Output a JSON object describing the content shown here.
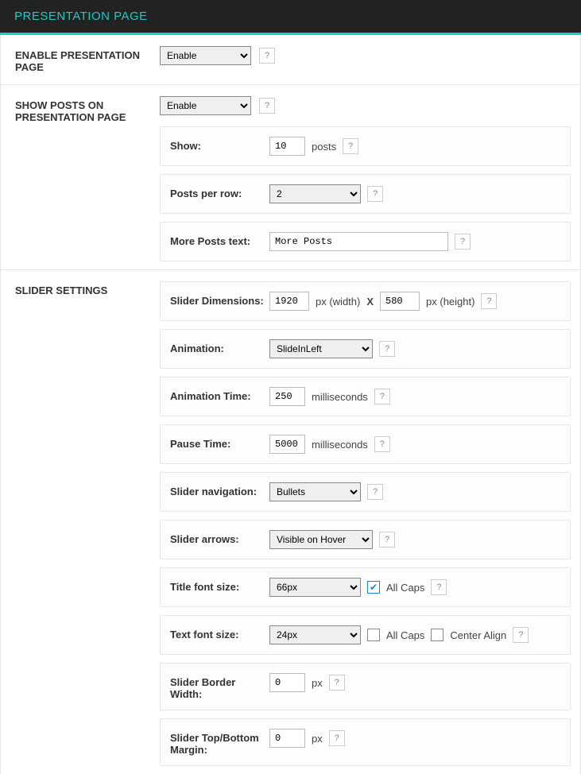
{
  "header": {
    "title": "PRESENTATION PAGE"
  },
  "enable_page": {
    "label": "Enable Presentation Page",
    "value": "Enable"
  },
  "show_posts": {
    "label": "Show Posts on Presentation Page",
    "value": "Enable",
    "show": {
      "label": "Show:",
      "value": "10",
      "unit": "posts"
    },
    "per_row": {
      "label": "Posts per row:",
      "value": "2"
    },
    "more_text": {
      "label": "More Posts text:",
      "value": "More Posts"
    }
  },
  "slider": {
    "label": "Slider Settings",
    "dimensions": {
      "label": "Slider Dimensions:",
      "width": "1920",
      "width_unit": "px (width)",
      "sep": "X",
      "height": "580",
      "height_unit": "px (height)"
    },
    "animation": {
      "label": "Animation:",
      "value": "SlideInLeft"
    },
    "animation_time": {
      "label": "Animation Time:",
      "value": "250",
      "unit": "milliseconds"
    },
    "pause_time": {
      "label": "Pause Time:",
      "value": "5000",
      "unit": "milliseconds"
    },
    "navigation": {
      "label": "Slider navigation:",
      "value": "Bullets"
    },
    "arrows": {
      "label": "Slider arrows:",
      "value": "Visible on Hover"
    },
    "title_font": {
      "label": "Title font size:",
      "value": "66px",
      "allcaps_label": "All Caps",
      "allcaps": true
    },
    "text_font": {
      "label": "Text font size:",
      "value": "24px",
      "allcaps_label": "All Caps",
      "allcaps": false,
      "center_label": "Center Align",
      "center": false
    },
    "border_width": {
      "label": "Slider Border Width:",
      "value": "0",
      "unit": "px"
    },
    "margin": {
      "label": "Slider Top/Bottom Margin:",
      "value": "0",
      "unit": "px"
    }
  },
  "help_glyph": "?"
}
